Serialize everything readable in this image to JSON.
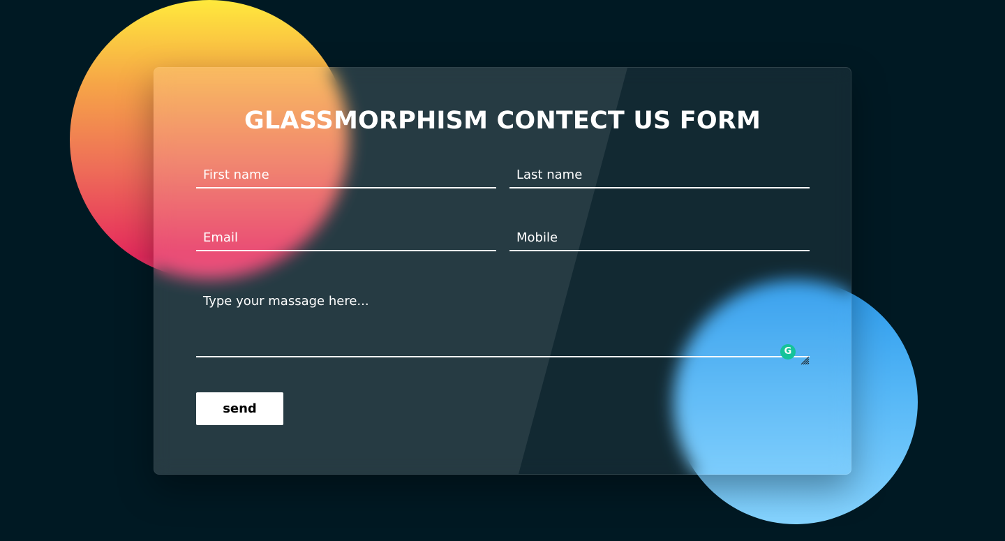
{
  "form": {
    "title": "GLASSMORPHISM CONTECT US FORM",
    "first_name_placeholder": "First name",
    "last_name_placeholder": "Last name",
    "email_placeholder": "Email",
    "mobile_placeholder": "Mobile",
    "message_placeholder": "Type your massage here...",
    "send_label": "send"
  },
  "icons": {
    "grammarly": "grammarly-icon",
    "grammarly_glyph": "G",
    "resize": "resize-handle-icon"
  },
  "colors": {
    "background": "#001923",
    "warm_circle_top": "#ffe93c",
    "warm_circle_bottom": "#e62a5d",
    "cool_circle_top": "#2b9aec",
    "cool_circle_bottom": "#86d4ff",
    "grammarly_green": "#15c39a",
    "button_bg": "#ffffff"
  }
}
